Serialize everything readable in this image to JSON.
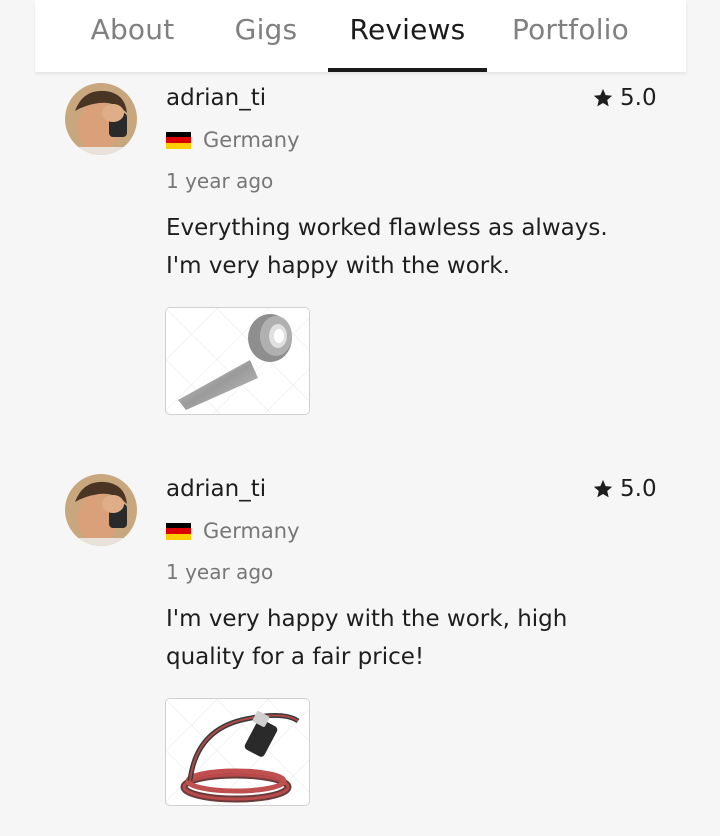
{
  "tabs": [
    {
      "label": "About",
      "active": false
    },
    {
      "label": "Gigs",
      "active": false
    },
    {
      "label": "Reviews",
      "active": true
    },
    {
      "label": "Portfolio",
      "active": false
    }
  ],
  "reviews": [
    {
      "username": "adrian_ti",
      "rating": "5.0",
      "country": "Germany",
      "time": "1 year ago",
      "text": "Everything worked flawless as always.\nI'm very happy with the work.",
      "image_subject": "metal-tape-roll"
    },
    {
      "username": "adrian_ti",
      "rating": "5.0",
      "country": "Germany",
      "time": "1 year ago",
      "text": "I'm very happy with the work, high\nquality for a fair price!",
      "image_subject": "red-black-cable-coil"
    }
  ],
  "colors": {
    "background": "#f6f6f6",
    "active_tab": "#1a1a1a",
    "inactive_tab": "#808080",
    "flag": [
      "#000000",
      "#dd0000",
      "#ffce00"
    ]
  }
}
